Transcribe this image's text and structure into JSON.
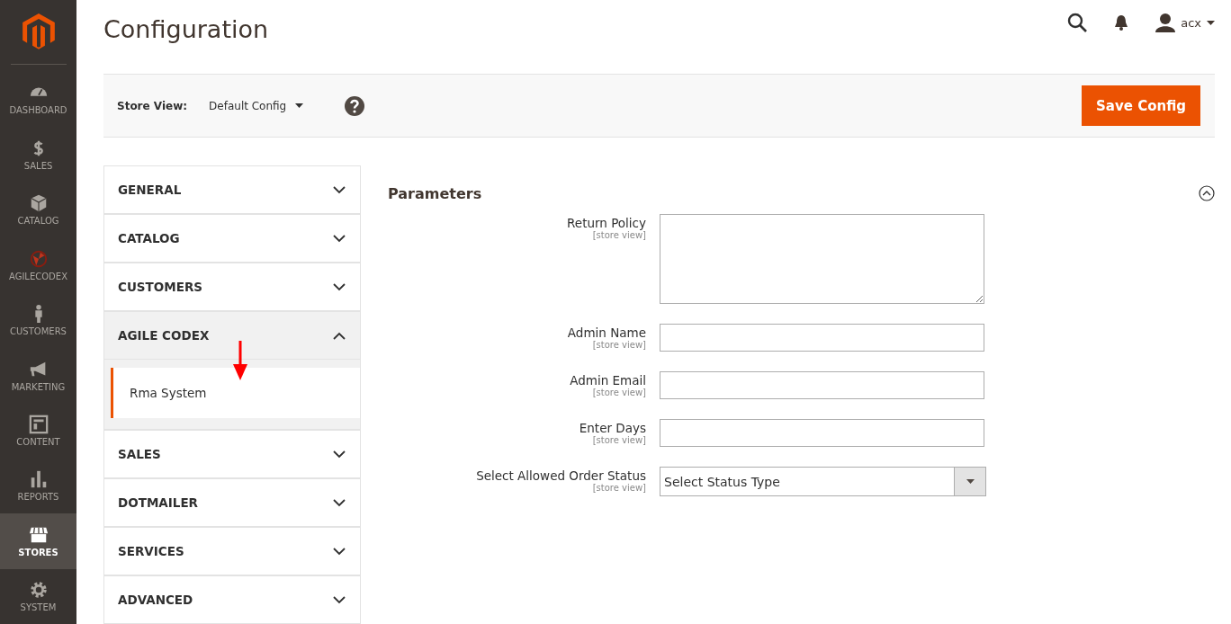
{
  "nav": [
    {
      "label": "DASHBOARD",
      "kind": "dashboard",
      "selected": false
    },
    {
      "label": "SALES",
      "kind": "sales",
      "selected": false
    },
    {
      "label": "CATALOG",
      "kind": "catalog",
      "selected": false
    },
    {
      "label": "AGILECODEX",
      "kind": "agilecodex",
      "selected": false
    },
    {
      "label": "CUSTOMERS",
      "kind": "customers",
      "selected": false
    },
    {
      "label": "MARKETING",
      "kind": "marketing",
      "selected": false
    },
    {
      "label": "CONTENT",
      "kind": "content",
      "selected": false
    },
    {
      "label": "REPORTS",
      "kind": "reports",
      "selected": false
    },
    {
      "label": "STORES",
      "kind": "stores",
      "selected": true
    },
    {
      "label": "SYSTEM",
      "kind": "system",
      "selected": false
    }
  ],
  "page_title": "Configuration",
  "user": "acx",
  "store_view": {
    "label": "Store View:",
    "value": "Default Config"
  },
  "save_button": "Save Config",
  "sections": [
    {
      "label": "GENERAL",
      "expanded": false
    },
    {
      "label": "CATALOG",
      "expanded": false
    },
    {
      "label": "CUSTOMERS",
      "expanded": false
    },
    {
      "label": "AGILE CODEX",
      "expanded": true,
      "children": [
        {
          "label": "Rma System",
          "selected": true
        }
      ]
    },
    {
      "label": "SALES",
      "expanded": false
    },
    {
      "label": "DOTMAILER",
      "expanded": false
    },
    {
      "label": "SERVICES",
      "expanded": false
    },
    {
      "label": "ADVANCED",
      "expanded": false
    }
  ],
  "group": {
    "title": "Parameters",
    "expanded": true,
    "fields": [
      {
        "label": "Return Policy",
        "scope": "[store view]",
        "kind": "textarea"
      },
      {
        "label": "Admin Name",
        "scope": "[store view]",
        "kind": "text"
      },
      {
        "label": "Admin Email",
        "scope": "[store view]",
        "kind": "text"
      },
      {
        "label": "Enter Days",
        "scope": "[store view]",
        "kind": "text"
      },
      {
        "label": "Select Allowed Order Status",
        "scope": "[store view]",
        "kind": "select",
        "value": "Select Status Type"
      }
    ]
  }
}
